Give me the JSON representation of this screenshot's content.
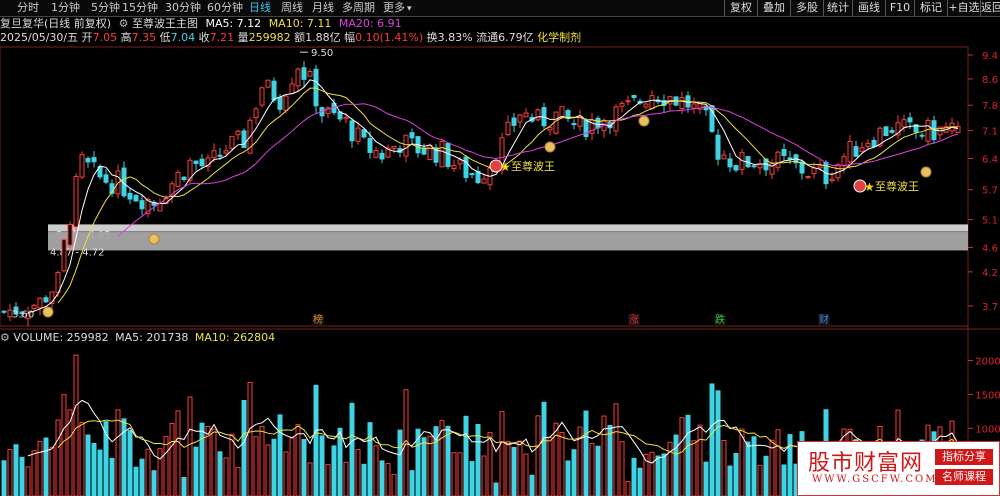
{
  "toolbar": {
    "tabs": [
      {
        "label": "分时",
        "active": false
      },
      {
        "label": "1分钟",
        "active": false
      },
      {
        "label": "5分钟",
        "active": false
      },
      {
        "label": "15分钟",
        "active": false
      },
      {
        "label": "30分钟",
        "active": false
      },
      {
        "label": "60分钟",
        "active": false
      },
      {
        "label": "日线",
        "active": true
      },
      {
        "label": "周线",
        "active": false
      },
      {
        "label": "月线",
        "active": false
      },
      {
        "label": "多周期",
        "active": false
      },
      {
        "label": "更多",
        "active": false
      }
    ],
    "more_arrow": "▾",
    "right_buttons": [
      "复权",
      "叠加",
      "多股",
      "统计",
      "画线",
      "F10",
      "标记",
      "+自选",
      "返回"
    ]
  },
  "header": {
    "stock_name": "复旦复华",
    "mode": "(日线 前复权)",
    "indicator_icon": "gear-icon",
    "indicator_name": "至尊波王主图",
    "ma5_label": "MA5: 7.12",
    "ma10_label": "MA10: 7.11",
    "ma20_label": "MA20: 6.91"
  },
  "quote": {
    "date": "2025/05/30/五",
    "open_label": "开",
    "open": "7.05",
    "high_label": "高",
    "high": "7.35",
    "low_label": "低",
    "low": "7.04",
    "close_label": "收",
    "close": "7.21",
    "volume_label": "量",
    "volume": "259982",
    "amount_label": "额",
    "amount": "1.88亿",
    "change_label": "幅",
    "change": "0.10(1.41%)",
    "turnover_label": "换",
    "turnover": "3.83%",
    "float_label": "流通",
    "float_value": "6.79亿",
    "sector": "化学制剂"
  },
  "volume_header": {
    "volume_label": "VOLUME: 259982",
    "ma5_label": "MA5: 201738",
    "ma10_label": "MA10: 262804"
  },
  "chart_data": [
    {
      "type": "candlestick",
      "title": "至尊波王主图",
      "y_axis_ticks": [
        "9.4",
        "8.6",
        "7.8",
        "7.1",
        "6.4",
        "5.7",
        "5.1",
        "4.6",
        "4.2",
        "3.7"
      ],
      "y_scale": "log",
      "ylim": [
        3.5,
        9.9
      ],
      "high_marker": "9.50",
      "low_marker": "3.60",
      "zones": [
        {
          "label": "5.01 - 4.95",
          "low": 4.95,
          "high": 5.01
        },
        {
          "label": "4.87 - 4.72",
          "low": 4.72,
          "high": 4.87
        }
      ],
      "signal_label": "至尊波王",
      "event_badges": [
        {
          "text": "榜",
          "color": "#e08a2c"
        },
        {
          "text": "涨",
          "color": "#e03030"
        },
        {
          "text": "跌",
          "color": "#3fbf3f"
        },
        {
          "text": "财",
          "color": "#3a8be0"
        }
      ],
      "series": [
        {
          "name": "MA5",
          "color": "#ffffff"
        },
        {
          "name": "MA10",
          "color": "#f0e040"
        },
        {
          "name": "MA20",
          "color": "#e040e0"
        }
      ]
    },
    {
      "type": "bar",
      "title": "VOLUME",
      "y_axis_ticks": [
        "2000",
        "1500",
        "1000"
      ],
      "ylim": [
        0,
        2230
      ],
      "series": [
        {
          "name": "VOLUME"
        },
        {
          "name": "MA5",
          "color": "#ffffff"
        },
        {
          "name": "MA10",
          "color": "#f0e040"
        }
      ]
    }
  ],
  "watermark": {
    "title": "股市财富网",
    "url": "WWW.GSCFW.COM",
    "tag1": "指标分享",
    "tag2": "名师课程"
  },
  "colors": {
    "up": "#ff3b3b",
    "down": "#3ed4e4",
    "ma5": "#ffffff",
    "ma10": "#f0e040",
    "ma20": "#e040e0",
    "tab_active": "#3ec8e8",
    "quote_open": "#ff3b3b",
    "quote_low": "#3ed4e4",
    "sector": "#f0e040"
  }
}
